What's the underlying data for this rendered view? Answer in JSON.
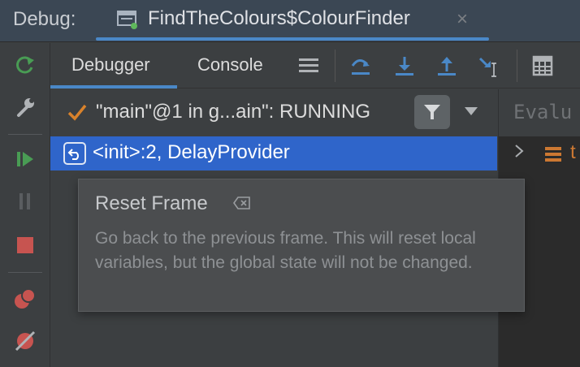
{
  "topbar": {
    "debug_label": "Debug:",
    "session_title": "FindTheColours$ColourFinder",
    "close_glyph": "×"
  },
  "tabs": {
    "debugger": "Debugger",
    "console": "Console"
  },
  "toolbar_icons": [
    "menu-icon",
    "step-over-icon",
    "step-into-icon",
    "step-out-icon",
    "run-to-cursor-icon",
    "evaluate-table-icon"
  ],
  "left_toolbar_icons": [
    "rerun-icon",
    "wrench-icon",
    "resume-icon",
    "pause-icon",
    "stop-icon",
    "view-breakpoints-icon",
    "mute-breakpoints-icon"
  ],
  "frames": {
    "thread_label": "\"main\"@1 in g...ain\": RUNNING",
    "selected_frame": "<init>:2, DelayProvider"
  },
  "variables": {
    "evaluate_placeholder": "Evalu",
    "first_var_text": "t"
  },
  "tooltip": {
    "title": "Reset Frame",
    "body": "Go back to the previous frame. This will reset local variables, but the global state will not be changed."
  },
  "colors": {
    "accent_blue": "#4a88c7",
    "selection_blue": "#2f65ca",
    "resume_green": "#499c54",
    "stop_red": "#c75450"
  }
}
